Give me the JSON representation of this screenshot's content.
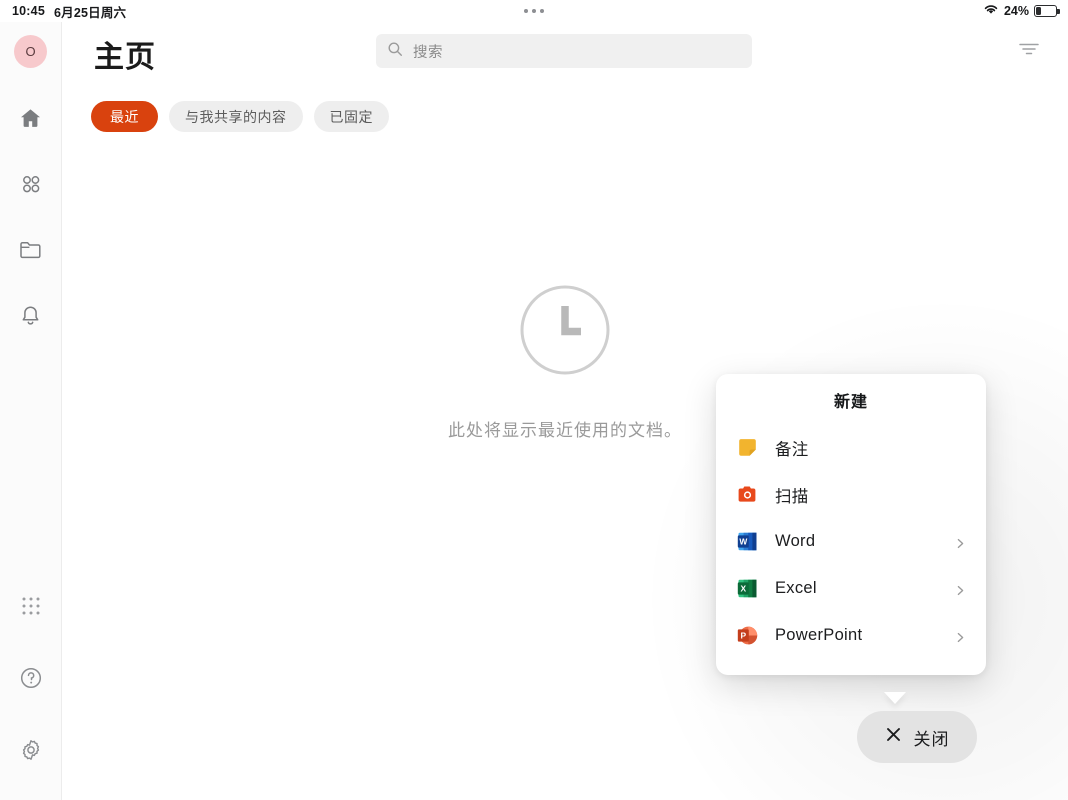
{
  "status_bar": {
    "time": "10:45",
    "date": "6月25日周六",
    "battery_percent": "24%",
    "battery_level": 24,
    "wifi_icon": "wifi-icon",
    "handle_icon": "three-dots-handle-icon"
  },
  "sidebar": {
    "avatar": {
      "initial": "O",
      "bg": "#f7c9cc"
    },
    "top_items": [
      {
        "icon": "home-icon",
        "name": "sidebar-item-home",
        "active": true
      },
      {
        "icon": "apps-grid-icon",
        "name": "sidebar-item-apps",
        "active": false
      },
      {
        "icon": "folder-icon",
        "name": "sidebar-item-files",
        "active": false
      },
      {
        "icon": "bell-icon",
        "name": "sidebar-item-notifications",
        "active": false
      }
    ],
    "bottom_items": [
      {
        "icon": "dots-grid-icon",
        "name": "sidebar-item-more-apps"
      },
      {
        "icon": "help-circle-icon",
        "name": "sidebar-item-help"
      },
      {
        "icon": "gear-icon",
        "name": "sidebar-item-settings"
      }
    ]
  },
  "header": {
    "title": "主页",
    "search": {
      "placeholder": "搜索",
      "value": "",
      "icon": "search-icon"
    },
    "filter_icon": "filter-icon"
  },
  "chips": [
    {
      "label": "最近",
      "active": true
    },
    {
      "label": "与我共享的内容",
      "active": false
    },
    {
      "label": "已固定",
      "active": false
    }
  ],
  "empty_state": {
    "icon": "clock-icon",
    "message": "此处将显示最近使用的文档。"
  },
  "popup": {
    "title": "新建",
    "items": [
      {
        "label": "备注",
        "icon": "sticky-note-icon",
        "color": "#f2b42e",
        "has_chevron": false
      },
      {
        "label": "扫描",
        "icon": "camera-scan-icon",
        "color": "#e8491c",
        "has_chevron": false
      },
      {
        "label": "Word",
        "icon": "word-icon",
        "color": "#2b5797",
        "has_chevron": true
      },
      {
        "label": "Excel",
        "icon": "excel-icon",
        "color": "#1d7a45",
        "has_chevron": true
      },
      {
        "label": "PowerPoint",
        "icon": "powerpoint-icon",
        "color": "#d24726",
        "has_chevron": true
      }
    ]
  },
  "close_button": {
    "label": "关闭",
    "icon": "close-x-icon"
  },
  "colors": {
    "accent": "#d9420e",
    "chip_inactive_bg": "#eeeeee",
    "search_bg": "#f0f0f0",
    "sidebar_bg": "#fbfbfb",
    "muted_text": "#9a9a9a"
  }
}
